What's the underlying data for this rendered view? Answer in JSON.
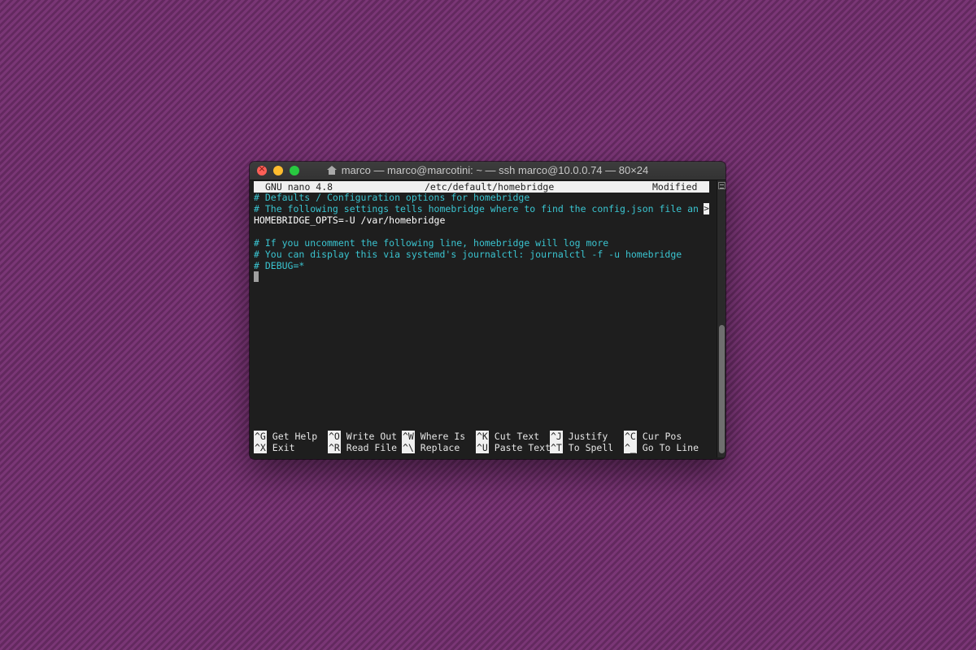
{
  "window": {
    "title": "marco — marco@marcotini: ~ — ssh marco@10.0.0.74 — 80×24",
    "traffic_lights": {
      "close": "#ff5f57",
      "minimize": "#febc2e",
      "maximize": "#28c840"
    }
  },
  "nano": {
    "version": "GNU nano 4.8",
    "file_path": "/etc/default/homebridge",
    "state": "Modified",
    "lines": [
      "# Defaults / Configuration options for homebridge",
      "# The following settings tells homebridge where to find the config.json file an",
      "HOMEBRIDGE_OPTS=-U /var/homebridge",
      "",
      "# If you uncomment the following line, homebridge will log more",
      "# You can display this via systemd's journalctl: journalctl -f -u homebridge",
      "# DEBUG=*"
    ],
    "overflow_marker": ">",
    "shortcuts_row1": [
      {
        "key": "^G",
        "label": "Get Help"
      },
      {
        "key": "^O",
        "label": "Write Out"
      },
      {
        "key": "^W",
        "label": "Where Is"
      },
      {
        "key": "^K",
        "label": "Cut Text"
      },
      {
        "key": "^J",
        "label": "Justify"
      },
      {
        "key": "^C",
        "label": "Cur Pos"
      }
    ],
    "shortcuts_row2": [
      {
        "key": "^X",
        "label": "Exit"
      },
      {
        "key": "^R",
        "label": "Read File"
      },
      {
        "key": "^\\",
        "label": "Replace"
      },
      {
        "key": "^U",
        "label": "Paste Text"
      },
      {
        "key": "^T",
        "label": "To Spell"
      },
      {
        "key": "^_",
        "label": "Go To Line"
      }
    ]
  },
  "colors": {
    "terminal_bg": "#1e1e1e",
    "comment_text": "#3ac4d0",
    "status_bar_bg": "#f0f0f0"
  }
}
